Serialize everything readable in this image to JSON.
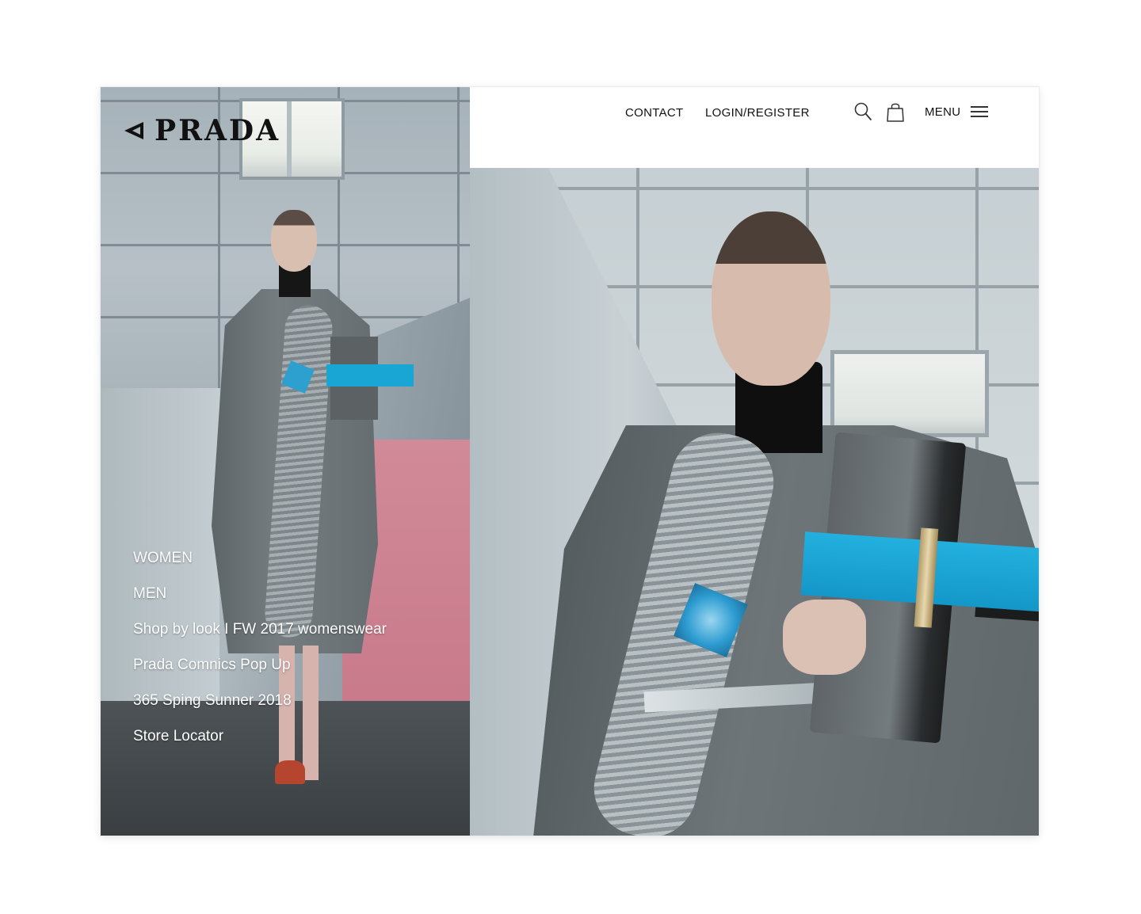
{
  "brand": {
    "logo_text": "PRADA"
  },
  "header": {
    "contact_label": "CONTACT",
    "login_label": "LOGIN/REGISTER",
    "menu_label": "MENU"
  },
  "icons": {
    "search": "search-icon",
    "bag": "shopping-bag-icon",
    "menu": "hamburger-icon",
    "logo": "prada-triangle-logo"
  },
  "side_nav": {
    "items": [
      {
        "label": "WOMEN"
      },
      {
        "label": "MEN"
      },
      {
        "label": "Shop by look I FW 2017 womenswear"
      },
      {
        "label": "Prada Comnics Pop Up"
      },
      {
        "label": "365 Sping Sunner 2018"
      },
      {
        "label": "Store Locator"
      }
    ]
  },
  "colors": {
    "accent_blue": "#1aa6d4",
    "nav_text": "#ffffff",
    "header_text": "#111111",
    "pink_wall": "#d18a98"
  }
}
